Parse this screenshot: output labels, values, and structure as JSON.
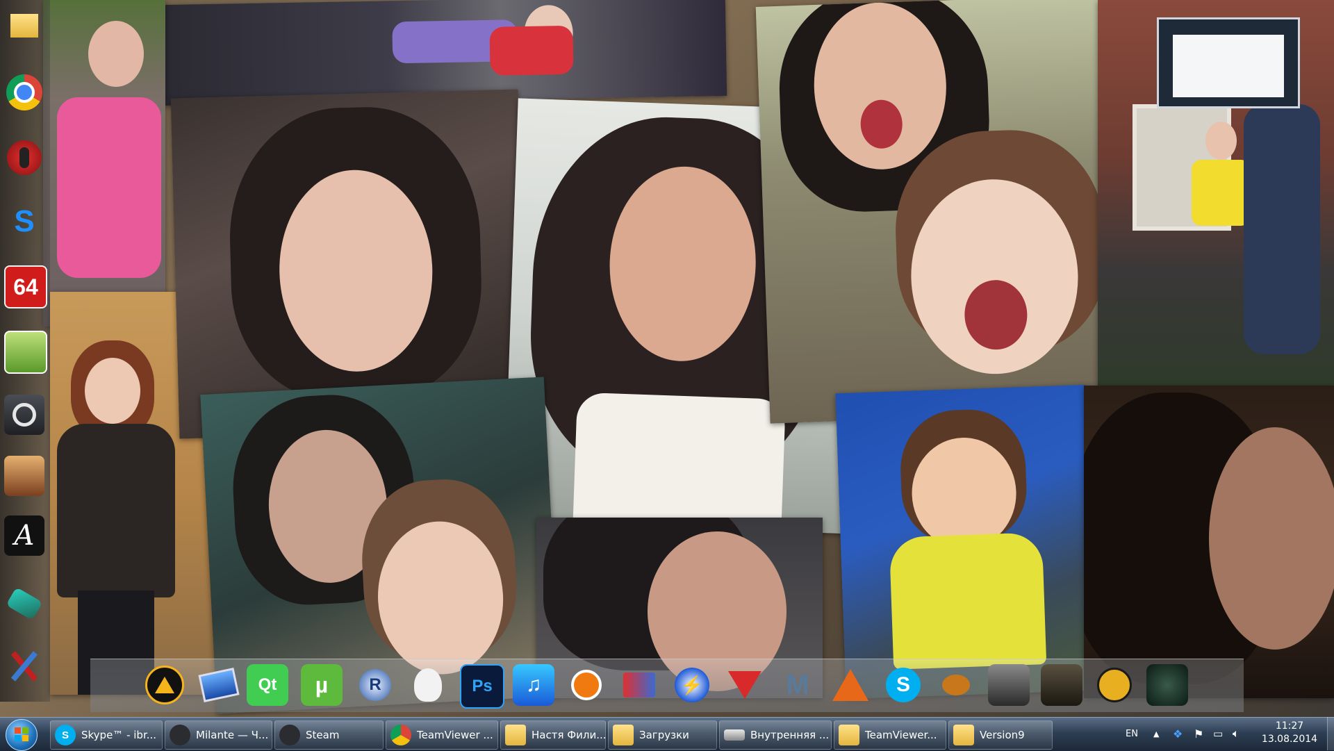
{
  "taskbar": {
    "items": [
      {
        "label": "Skype™ - ibr..."
      },
      {
        "label": "Milante — Ч..."
      },
      {
        "label": "Steam"
      },
      {
        "label": "TeamViewer ..."
      },
      {
        "label": "Настя Фили..."
      },
      {
        "label": "Загрузки"
      },
      {
        "label": "Внутренняя ..."
      },
      {
        "label": "TeamViewer..."
      },
      {
        "label": "Version9"
      }
    ]
  },
  "tray": {
    "language": "EN",
    "time": "11:27",
    "date": "13.08.2014"
  },
  "left_dock": {
    "items": [
      {
        "icon": "folder-download-icon"
      },
      {
        "icon": "chrome-icon"
      },
      {
        "icon": "microphone-icon"
      },
      {
        "icon": "shazam-icon"
      },
      {
        "icon": "aida64-icon",
        "label": "64"
      },
      {
        "icon": "image-editor-icon"
      },
      {
        "icon": "steam-icon"
      },
      {
        "icon": "game-icon"
      },
      {
        "icon": "font-icon",
        "label": "A"
      },
      {
        "icon": "game-device-icon"
      },
      {
        "icon": "tools-icon"
      }
    ]
  },
  "dock": {
    "items": [
      {
        "icon": "aimp-icon"
      },
      {
        "icon": "computer-icon"
      },
      {
        "icon": "qt-icon",
        "label": "Qt"
      },
      {
        "icon": "utorrent-icon",
        "label": "µ"
      },
      {
        "icon": "revo-icon",
        "label": "R"
      },
      {
        "icon": "foobar-icon"
      },
      {
        "icon": "photoshop-icon",
        "label": "Ps"
      },
      {
        "icon": "itunes-icon"
      },
      {
        "icon": "avast-icon"
      },
      {
        "icon": "network-icon"
      },
      {
        "icon": "daemon-tools-icon"
      },
      {
        "icon": "record-icon"
      },
      {
        "icon": "m-app-icon",
        "label": "M"
      },
      {
        "icon": "matlab-icon"
      },
      {
        "icon": "skype-icon",
        "label": "S"
      },
      {
        "icon": "paint-icon"
      },
      {
        "icon": "game1-icon"
      },
      {
        "icon": "game2-icon"
      },
      {
        "icon": "game3-icon"
      },
      {
        "icon": "game4-icon"
      }
    ]
  },
  "colors": {
    "taskbar": "#2e3f54",
    "skype": "#00aff0",
    "chrome_red": "#db4437",
    "photoshop": "#2fa3f7",
    "utorrent": "#5dba3c"
  }
}
